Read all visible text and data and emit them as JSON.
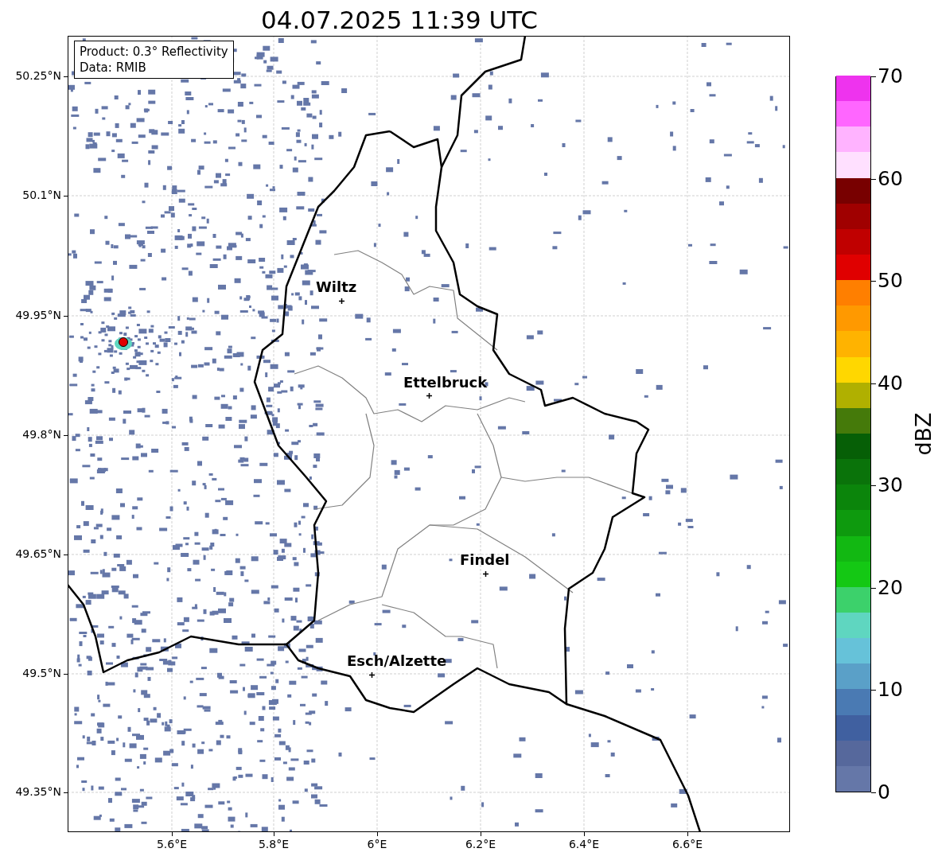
{
  "title": "04.07.2025 11:39 UTC",
  "map": {
    "legend": [
      "Product: 0.3° Reflectivity",
      "Data: RMIB"
    ],
    "cities": [
      {
        "name": "Wiltz"
      },
      {
        "name": "Ettelbruck"
      },
      {
        "name": "Findel"
      },
      {
        "name": "Esch/Alzette"
      }
    ],
    "x_ticks": [
      "5.6°E",
      "5.8°E",
      "6°E",
      "6.2°E",
      "6.4°E",
      "6.6°E"
    ],
    "y_ticks": [
      "50.25°N",
      "50.1°N",
      "49.95°N",
      "49.8°N",
      "49.65°N",
      "49.5°N",
      "49.35°N"
    ]
  },
  "colorbar": {
    "label": "dBZ",
    "ticks": [
      "70",
      "60",
      "50",
      "40",
      "30",
      "20",
      "10",
      "0"
    ],
    "colors": [
      {
        "color": "#6577a8"
      },
      {
        "color": "#56689c"
      },
      {
        "color": "#4060a0"
      },
      {
        "color": "#4a7ab3"
      },
      {
        "color": "#5aa0c8"
      },
      {
        "color": "#66c2d9"
      },
      {
        "color": "#5fd6c0"
      },
      {
        "color": "#3cd16b"
      },
      {
        "color": "#14c814"
      },
      {
        "color": "#12b812"
      },
      {
        "color": "#0e9a0e"
      },
      {
        "color": "#0b850b"
      },
      {
        "color": "#0a730a"
      },
      {
        "color": "#065f06"
      },
      {
        "color": "#457a0a"
      },
      {
        "color": "#b0b000"
      },
      {
        "color": "#ffd700"
      },
      {
        "color": "#ffb300"
      },
      {
        "color": "#ff9900"
      },
      {
        "color": "#ff7f00"
      },
      {
        "color": "#e00000"
      },
      {
        "color": "#c00000"
      },
      {
        "color": "#a00000"
      },
      {
        "color": "#780000"
      },
      {
        "color": "#ffe0ff"
      },
      {
        "color": "#ffb3ff"
      },
      {
        "color": "#ff66ff"
      },
      {
        "color": "#ee33ee"
      }
    ]
  }
}
